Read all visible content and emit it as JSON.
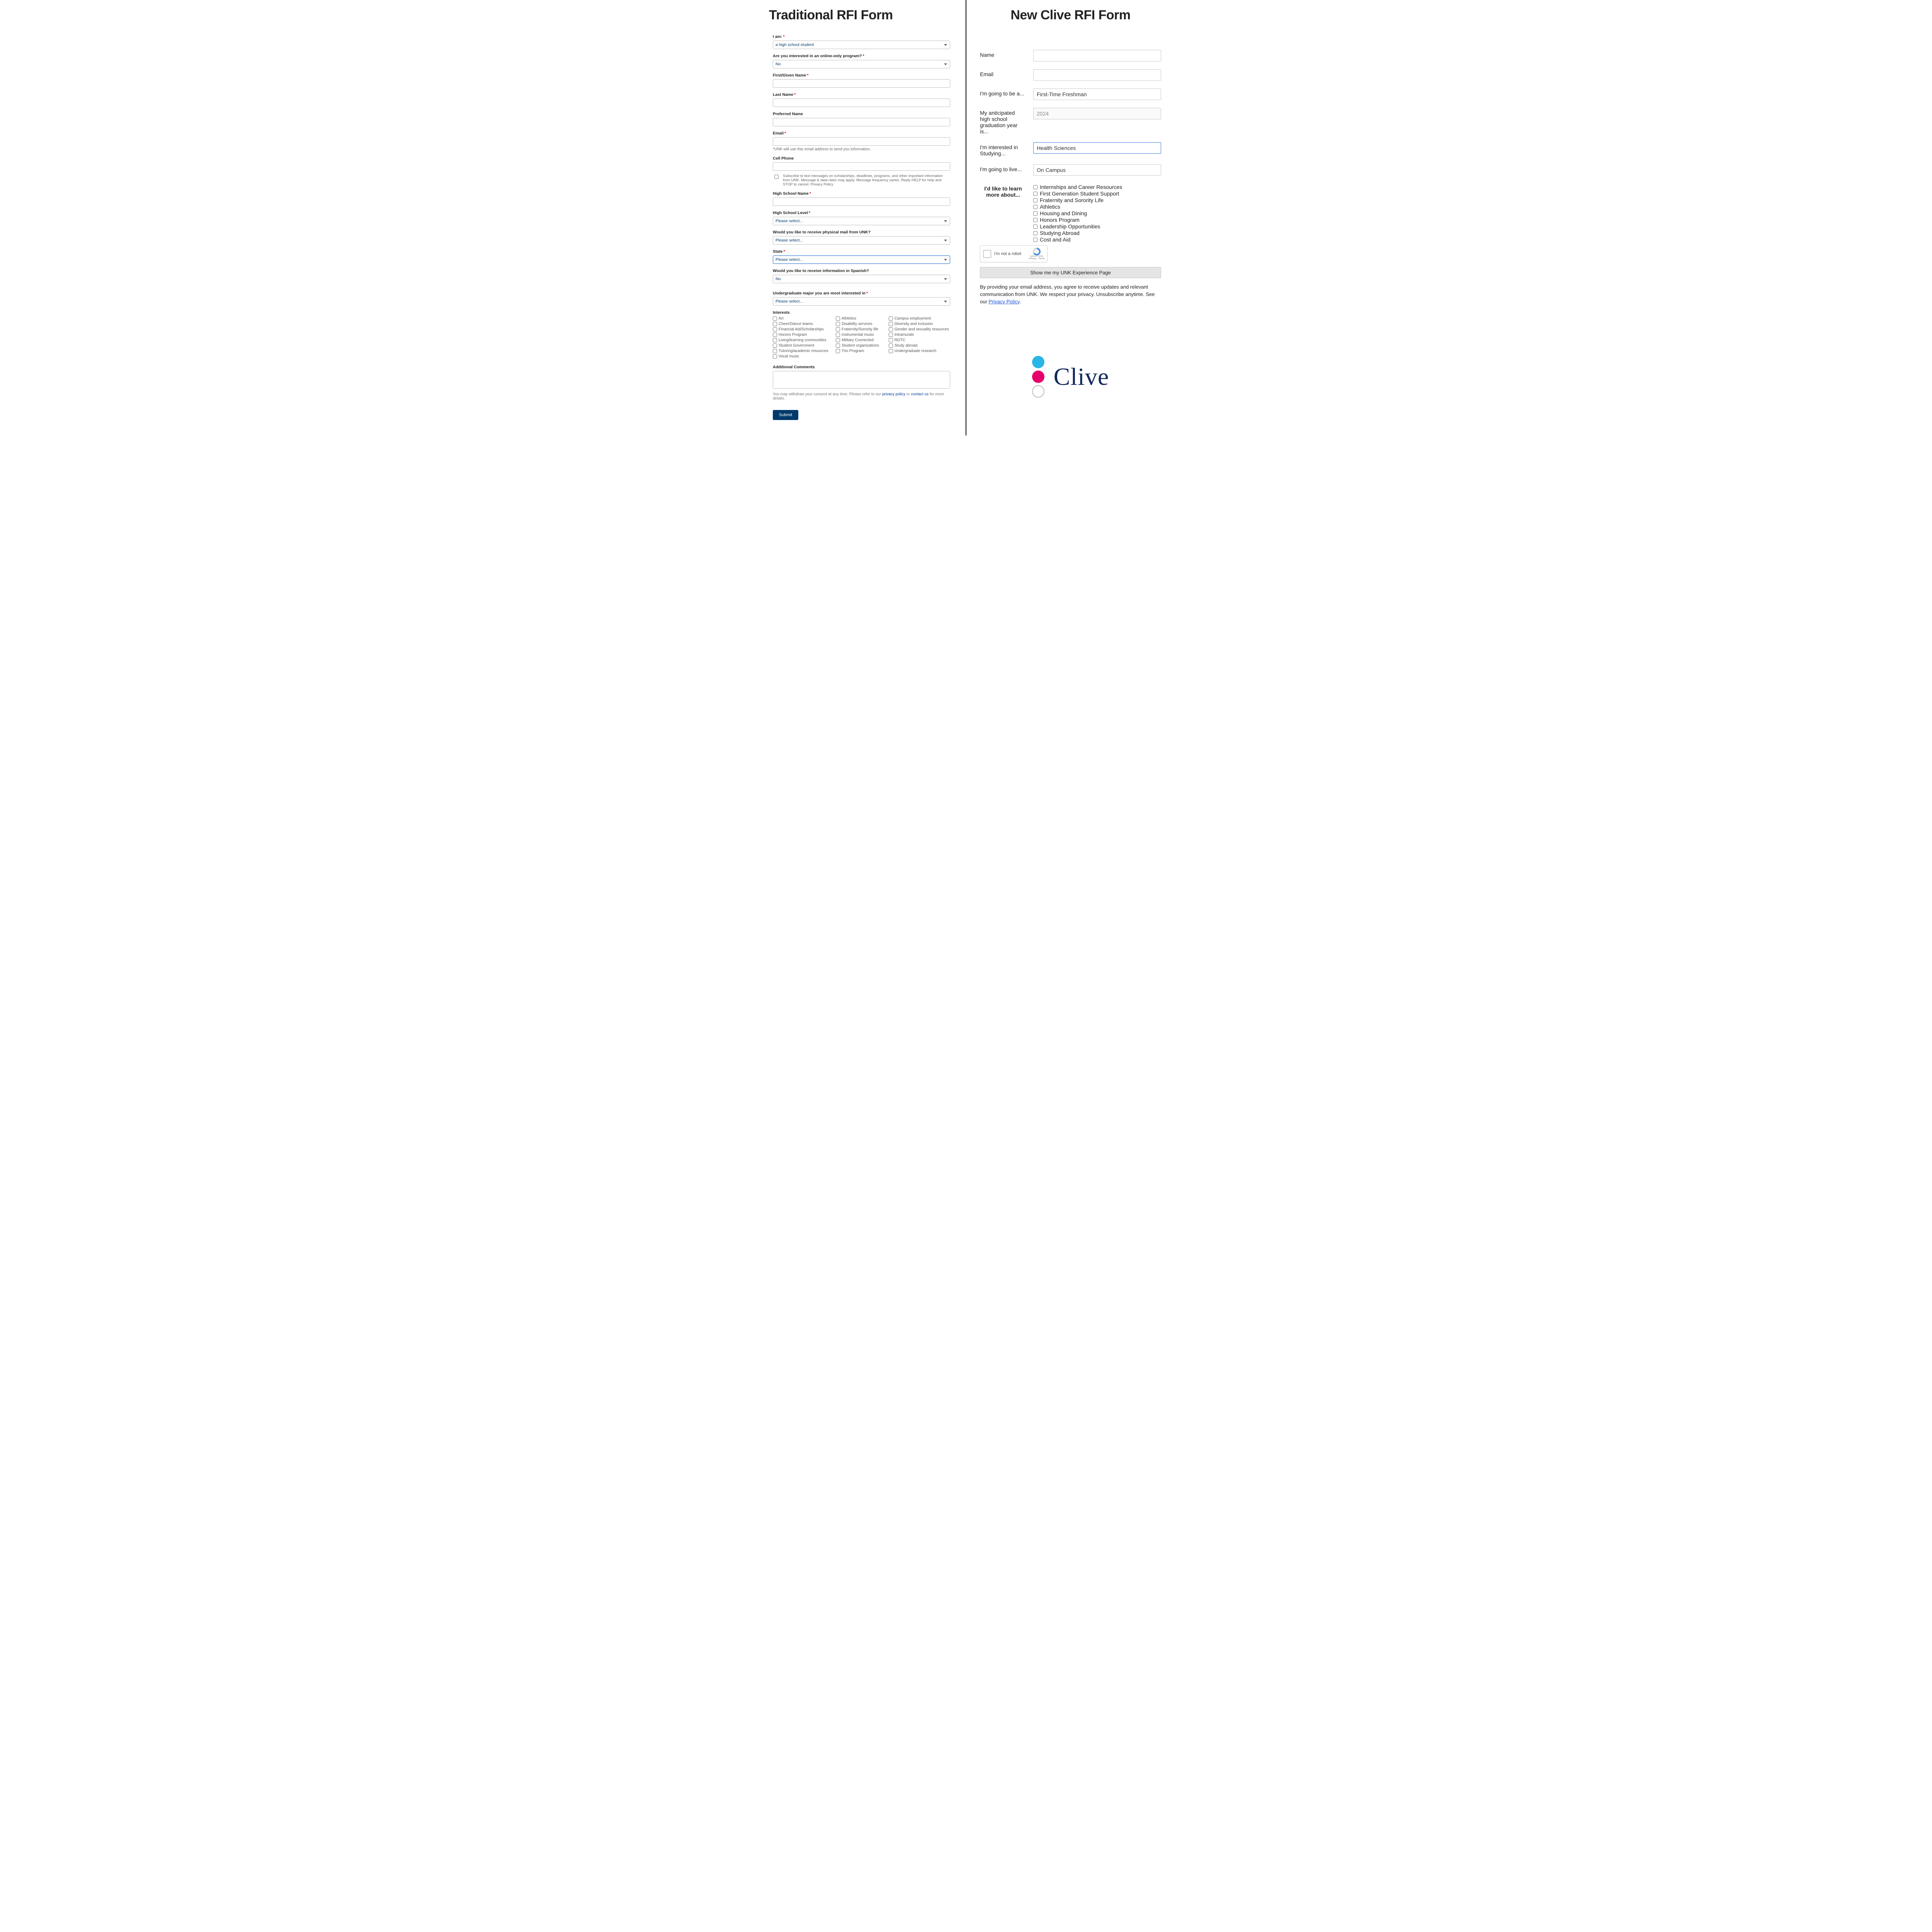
{
  "left": {
    "title": "Traditional RFI Form",
    "iam": {
      "label": "I am:",
      "value": "a high school student"
    },
    "online": {
      "label": "Are you interested in an online-only program?",
      "value": "No"
    },
    "firstName": {
      "label": "First/Given Name"
    },
    "lastName": {
      "label": "Last Name"
    },
    "preferredName": {
      "label": "Preferred Name"
    },
    "email": {
      "label": "Email",
      "hint": "*UNK will use this email address to send you information."
    },
    "cell": {
      "label": "Cell Phone",
      "sms": "Subscribe to text messages on scholarships, deadlines, programs, and other important information from UNK. Message & data rates may apply. Message frequency varies. Reply HELP for help and STOP to cancel.",
      "privacy": "Privacy Policy"
    },
    "hsName": {
      "label": "High School Name"
    },
    "hsLevel": {
      "label": "High School Level",
      "value": "Please select..."
    },
    "physicalMail": {
      "label": "Would you like to receive physical mail from UNK?",
      "value": "Please select..."
    },
    "state": {
      "label": "State",
      "value": "Please select..."
    },
    "spanish": {
      "label": "Would you like to receive information in Spanish?",
      "value": "No"
    },
    "major": {
      "label": "Undergraduate major you are most interested in",
      "value": "Please select..."
    },
    "interestsHeader": "Interests",
    "interests": [
      "Art",
      "Athletics",
      "Campus employment",
      "Cheer/Dance teams",
      "Disability services",
      "Diversity and inclusion",
      "Financial Aid/Scholarships",
      "Fraternity/Sorority life",
      "Gender and sexuality resources",
      "Honors Program",
      "Instrumental music",
      "Intramurals",
      "Living/learning communities",
      "Military Connected",
      "ROTC",
      "Student Government",
      "Student organizations",
      "Study abroad",
      "Tutoring/academic resources",
      "Trio Program",
      "Undergraduate research",
      "Vocal music"
    ],
    "comments": {
      "label": "Additional Comments"
    },
    "disclaimer": {
      "pre": "You may withdraw your consent at any time. Please refer to our ",
      "pp": "privacy policy",
      "or": " or ",
      "cu": "contact us",
      "post": " for more details."
    },
    "submit": "Submit"
  },
  "right": {
    "title": "New Clive RFI Form",
    "name": {
      "label": "Name"
    },
    "email": {
      "label": "Email"
    },
    "going": {
      "label": "I'm going to be a...",
      "value": "First-Time Freshman"
    },
    "grad": {
      "label": "My anticipated high school graduation year is...",
      "value": "2024"
    },
    "study": {
      "label": "I'm interested in Studying...",
      "value": "Health Sciences"
    },
    "live": {
      "label": "I'm going to live...",
      "value": "On Campus"
    },
    "learn": {
      "label": "I'd like to learn more about...",
      "items": [
        "Internships and Career Resources",
        "First Generation Student Support",
        "Fraternity and Sorority Life",
        "Athletics",
        "Housing and Dining",
        "Honors Program",
        "Leadership Opportunities",
        "Studying Abroad",
        "Cost and Aid"
      ]
    },
    "recaptcha": {
      "text": "I'm not a robot",
      "brand": "reCAPTCHA",
      "terms": "Privacy · Terms"
    },
    "submit": "Show me my UNK Experience Page",
    "consent": {
      "pre": "By providing your email address, you agree to receive updates and relevant communication from UNK. We respect your privacy. Unsubscribe anytime. See our ",
      "link": "Privacy Policy",
      "post": "."
    },
    "logoWord": "Clive"
  }
}
